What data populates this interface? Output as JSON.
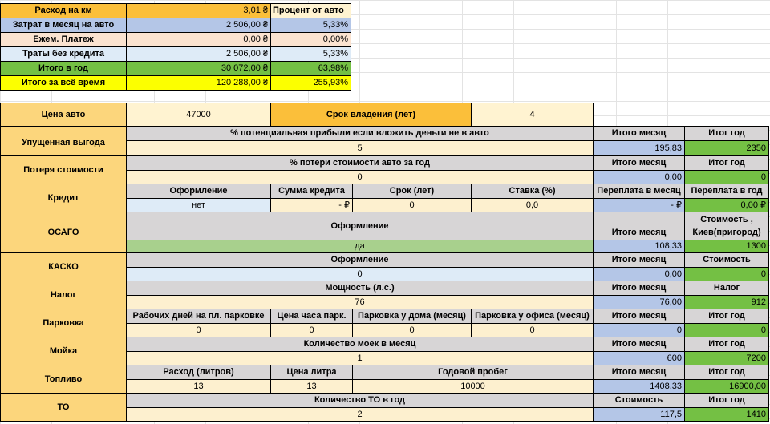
{
  "summary": {
    "rows": [
      {
        "label": "Расход на км",
        "value": "3,01 ₴",
        "pct": "Процент от авто"
      },
      {
        "label": "Затрат в месяц на авто",
        "value": "2 506,00 ₴",
        "pct": "5,33%"
      },
      {
        "label": "Ежем. Платеж",
        "value": "0,00 ₴",
        "pct": "0,00%"
      },
      {
        "label": "Траты без кредита",
        "value": "2 506,00 ₴",
        "pct": "5,33%"
      },
      {
        "label": "Итого в год",
        "value": "30 072,00 ₴",
        "pct": "63,98%"
      },
      {
        "label": "Итого за всё время",
        "value": "120 288,00 ₴",
        "pct": "255,93%"
      }
    ]
  },
  "top": {
    "price_label": "Цена авто",
    "price_value": "47000",
    "term_label": "Срок владения (лет)",
    "term_value": "4"
  },
  "sections": {
    "lost_profit": {
      "label": "Упущенная выгода",
      "header": "% потенциальная прибыли если вложить деньги не в авто",
      "value": "5",
      "rh1": "Итого месяц",
      "rh2": "Итог год",
      "rv1": "195,83",
      "rv2": "2350"
    },
    "depreciation": {
      "label": "Потеря стоимости",
      "header": "% потери стоимости авто за год",
      "value": "0",
      "rh1": "Итого месяц",
      "rh2": "Итог год",
      "rv1": "0,00",
      "rv2": "0"
    },
    "credit": {
      "label": "Кредит",
      "h1": "Оформление",
      "h2": "Сумма кредита",
      "h3": "Срок (лет)",
      "h4": "Ставка (%)",
      "v1": "нет",
      "v2": "-   ₽",
      "v3": "0",
      "v4": "0,0",
      "rh1": "Переплата в месяц",
      "rh2": "Переплата в год",
      "rv1": "-   ₽",
      "rv2": "0,00 ₽"
    },
    "osago": {
      "label": "ОСАГО",
      "header": "Оформление",
      "value": "да",
      "rh1": "Итого месяц",
      "rh2a": "Стоимость ,",
      "rh2b": "Киев(пригород)",
      "rv1": "108,33",
      "rv2": "1300"
    },
    "kasko": {
      "label": "КАСКО",
      "header": "Оформление",
      "value": "0",
      "rh1": "Итого месяц",
      "rh2": "Стоимость",
      "rv1": "0,00",
      "rv2": "0"
    },
    "tax": {
      "label": "Налог",
      "header": "Мощность (л.с.)",
      "value": "76",
      "rh1": "Итого месяц",
      "rh2": "Налог",
      "rv1": "76,00",
      "rv2": "912"
    },
    "parking": {
      "label": "Парковка",
      "h1": "Рабочих дней на пл. парковке",
      "h2": "Цена часа парк.",
      "h3": "Парковка у дома (месяц)",
      "h4": "Парковка у офиса (месяц)",
      "v1": "0",
      "v2": "0",
      "v3": "0",
      "v4": "0",
      "rh1": "Итого месяц",
      "rh2": "Итог год",
      "rv1": "0",
      "rv2": "0"
    },
    "wash": {
      "label": "Мойка",
      "header": "Количество моек в месяц",
      "value": "1",
      "rh1": "Итого месяц",
      "rh2": "Итог год",
      "rv1": "600",
      "rv2": "7200"
    },
    "fuel": {
      "label": "Топливо",
      "h1": "Расход (литров)",
      "h2": "Цена литра",
      "h3": "Годовой пробег",
      "v1": "13",
      "v2": "13",
      "v3": "10000",
      "rh1": "Итого месяц",
      "rh2": "Итог год",
      "rv1": "1408,33",
      "rv2": "16900,00"
    },
    "service": {
      "label": "ТО",
      "header": "Количество ТО в год",
      "value": "2",
      "rh1": "Стоимость",
      "rh2": "Итог год",
      "rv1": "117,5",
      "rv2": "1410"
    }
  }
}
